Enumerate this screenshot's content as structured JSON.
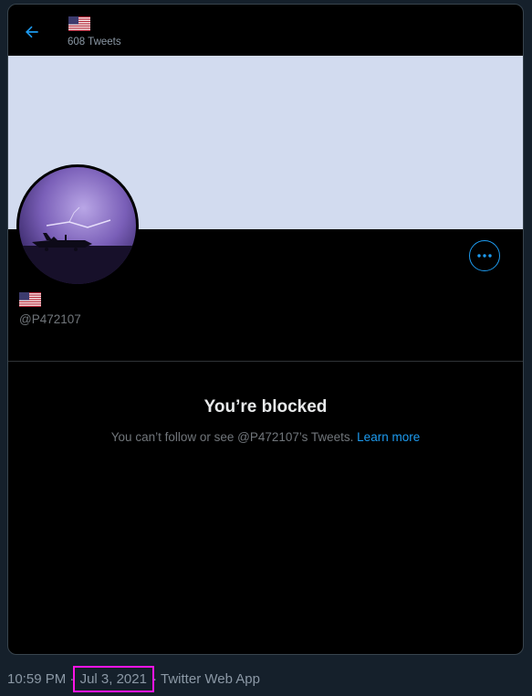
{
  "header": {
    "tweet_count": "608 Tweets",
    "flag_icon": "us-flag-icon"
  },
  "profile": {
    "handle": "@P472107",
    "flag_icon": "us-flag-icon"
  },
  "blocked": {
    "title": "You’re blocked",
    "message": "You can’t follow or see @P472107’s Tweets.",
    "learn_more": "Learn more"
  },
  "footer": {
    "time": "10:59 PM",
    "sep1": " · ",
    "date": "Jul 3, 2021",
    "sep2": " · ",
    "source": "Twitter Web App"
  },
  "colors": {
    "accent": "#1d9bf0",
    "banner": "#d2dbef",
    "page_bg": "#15202b",
    "highlight": "#ff14e6"
  }
}
